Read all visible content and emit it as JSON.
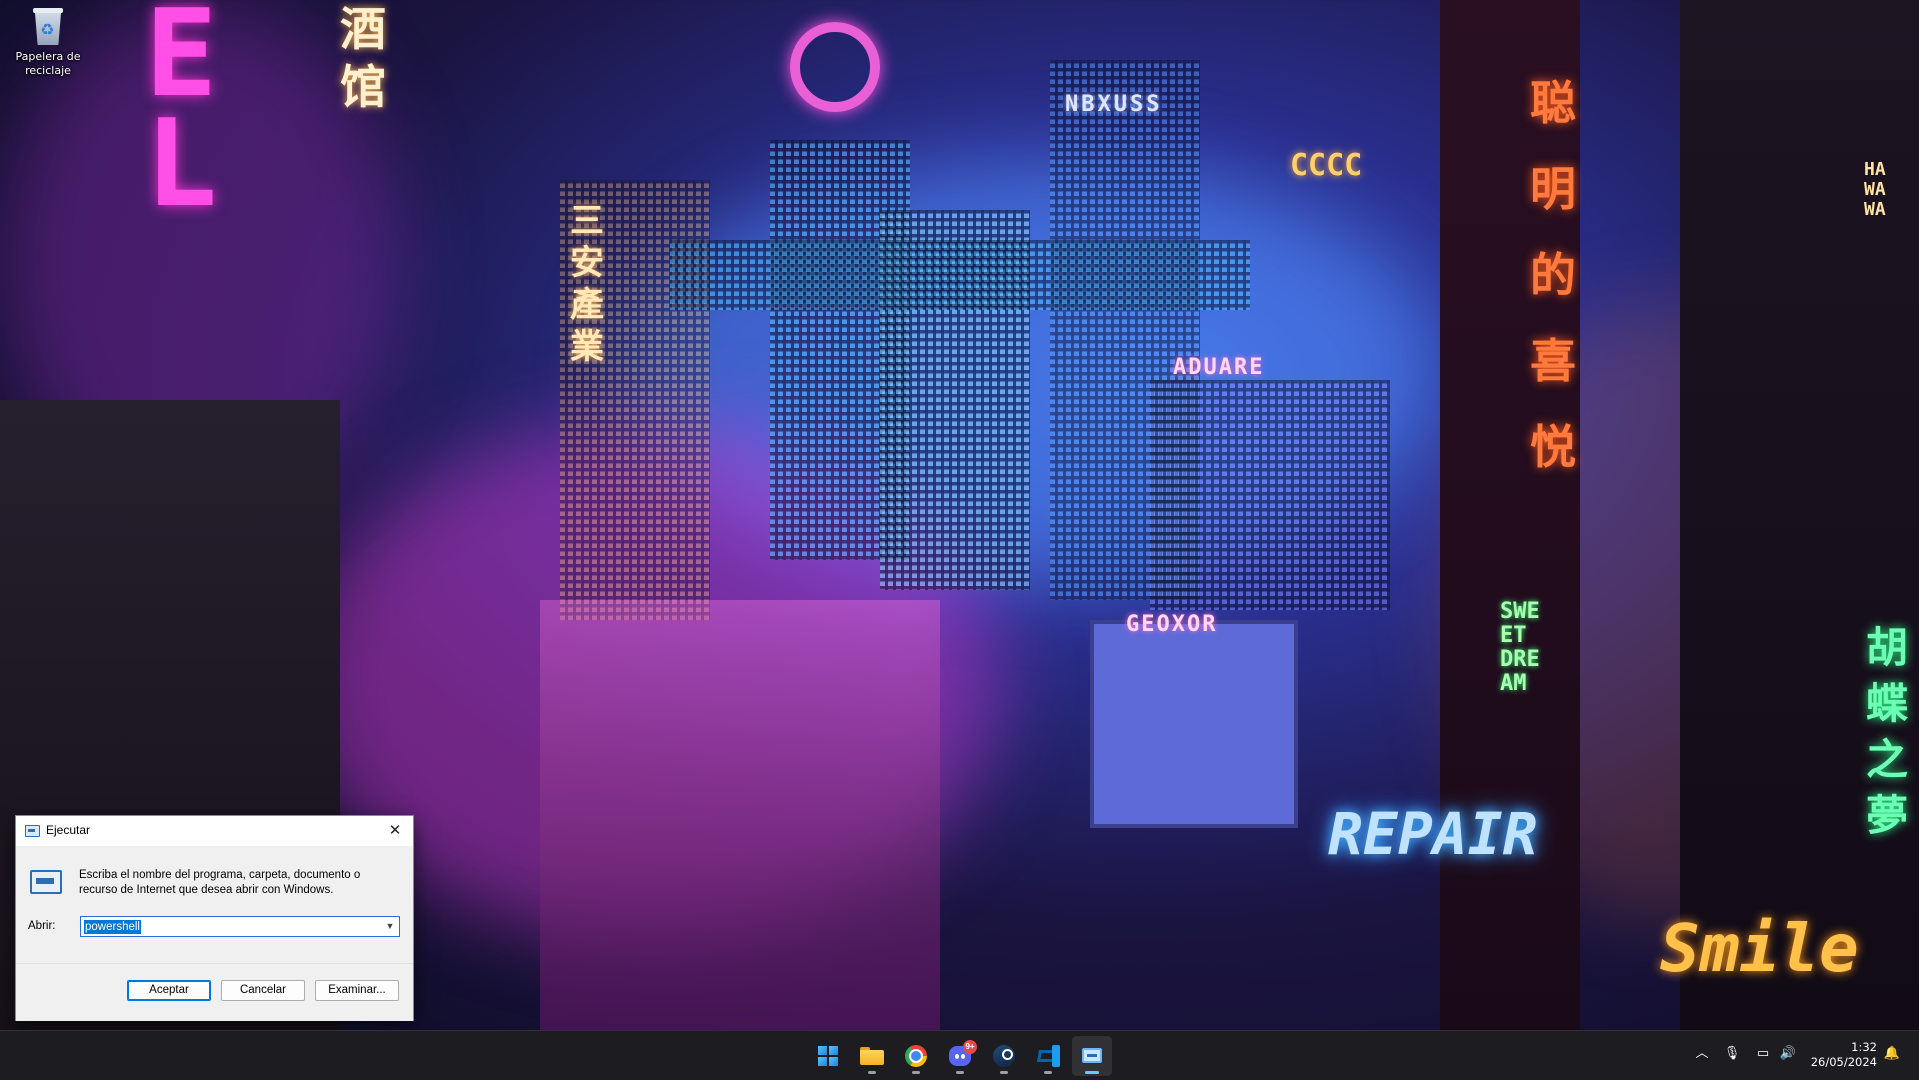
{
  "desktop": {
    "icons": [
      {
        "label": "Papelera de reciclaje",
        "icon": "recycle-bin-icon"
      }
    ]
  },
  "wallpaper": {
    "signs": [
      "NBXUSS",
      "CCCC",
      "ADUARE",
      "GEOXOR",
      "REPAIR",
      "SWEET DREAM",
      "HAWAWA",
      "三安產業",
      "酒馆",
      "聪明的喜悦",
      "胡蝶之夢",
      "Smile"
    ],
    "accent_colors": [
      "#ff2fd6",
      "#3fb3ff",
      "#7b2cff",
      "#ff8a2a"
    ]
  },
  "run_dialog": {
    "title": "Ejecutar",
    "description": "Escriba el nombre del programa, carpeta, documento o recurso de Internet que desea abrir con Windows.",
    "open_label": "Abrir:",
    "input_value": "powershell",
    "buttons": {
      "ok": "Aceptar",
      "cancel": "Cancelar",
      "browse": "Examinar..."
    }
  },
  "taskbar": {
    "apps": [
      {
        "name": "Inicio",
        "icon": "windows-start-icon"
      },
      {
        "name": "Explorador de archivos",
        "icon": "file-explorer-icon"
      },
      {
        "name": "Google Chrome",
        "icon": "chrome-icon"
      },
      {
        "name": "Discord",
        "icon": "discord-icon",
        "badge": "9+"
      },
      {
        "name": "Steam",
        "icon": "steam-icon"
      },
      {
        "name": "Visual Studio Code",
        "icon": "vscode-icon"
      },
      {
        "name": "Ejecutar",
        "icon": "run-icon"
      }
    ],
    "tray": {
      "time": "1:32",
      "date": "26/05/2024"
    }
  }
}
